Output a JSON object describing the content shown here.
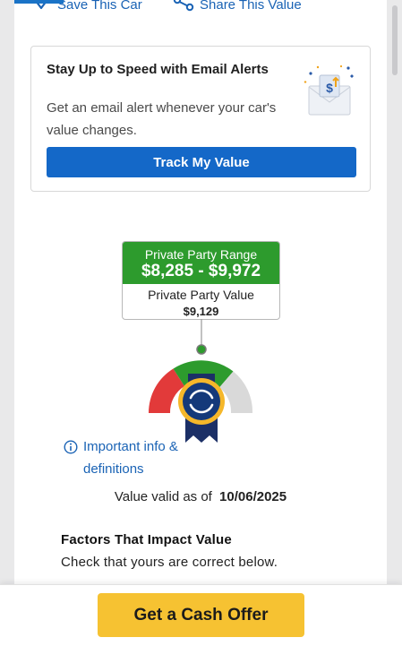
{
  "actions": {
    "save_label": "Save This Car",
    "share_label": "Share This Value"
  },
  "alert_card": {
    "title": "Stay Up to Speed with Email Alerts",
    "description": "Get an email alert whenever your car's value changes.",
    "button_label": "Track My Value",
    "illustration": "envelope-with-dollar-icon"
  },
  "value_box": {
    "range_label": "Private Party Range",
    "range_value": "$8,285 - $9,972",
    "ppv_label": "Private Party Value",
    "ppv_value": "$9,129"
  },
  "gauge": {
    "segments": [
      "low",
      "fair",
      "high"
    ],
    "segment_colors": [
      "#e23a3a",
      "#2d9b2d",
      "#d9d9d9"
    ],
    "badge_icon": "ribbon-badge-icon"
  },
  "info": {
    "link_label": "Important info & definitions"
  },
  "valid": {
    "prefix": "Value valid as of",
    "date": "10/06/2025"
  },
  "factors": {
    "title": "Factors That Impact Value",
    "description": "Check that yours are correct below."
  },
  "footer": {
    "cash_offer_label": "Get a Cash Offer"
  },
  "colors": {
    "primary_blue": "#1468c8",
    "link_blue": "#1a63b5",
    "green": "#2d9b2d",
    "cta_yellow": "#f6c232"
  }
}
